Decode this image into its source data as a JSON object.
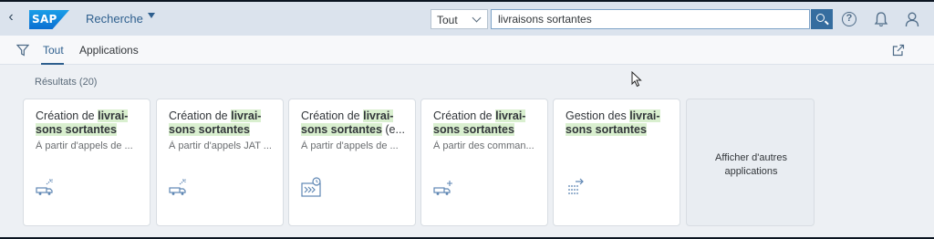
{
  "header": {
    "title": "Recherche",
    "scope": "Tout",
    "search_value": "livraisons sortantes"
  },
  "tabs": [
    {
      "label": "Tout"
    },
    {
      "label": "Applications"
    }
  ],
  "results_count": "Résultats (20)",
  "tiles": [
    {
      "title_a": "Création de ",
      "title_hl": "livrai-sons sortantes",
      "title_b": "",
      "subtitle": "À partir d'appels de ...",
      "icon": "truck-arrow-icon"
    },
    {
      "title_a": "Création de ",
      "title_hl": "livrai-sons sortantes",
      "title_b": "",
      "subtitle": "À partir d'appels JAT ...",
      "icon": "truck-arrow-icon"
    },
    {
      "title_a": "Création de ",
      "title_hl": "livrai-sons sortantes",
      "title_b": " (e...",
      "subtitle": "À partir d'appels de ...",
      "icon": "process-clock-icon"
    },
    {
      "title_a": "Création de ",
      "title_hl": "livrai-sons sortantes",
      "title_b": "",
      "subtitle": "À partir des comman...",
      "icon": "truck-plus-icon"
    },
    {
      "title_a": "Gestion des ",
      "title_hl": "livrai-sons sortantes",
      "title_b": "",
      "subtitle": "",
      "icon": "list-arrow-icon"
    }
  ],
  "more_tile": {
    "label": "Afficher d'autres applications"
  },
  "colors": {
    "accent": "#2e5f8e",
    "highlight": "#d9efcf",
    "search_button": "#356d9f"
  }
}
